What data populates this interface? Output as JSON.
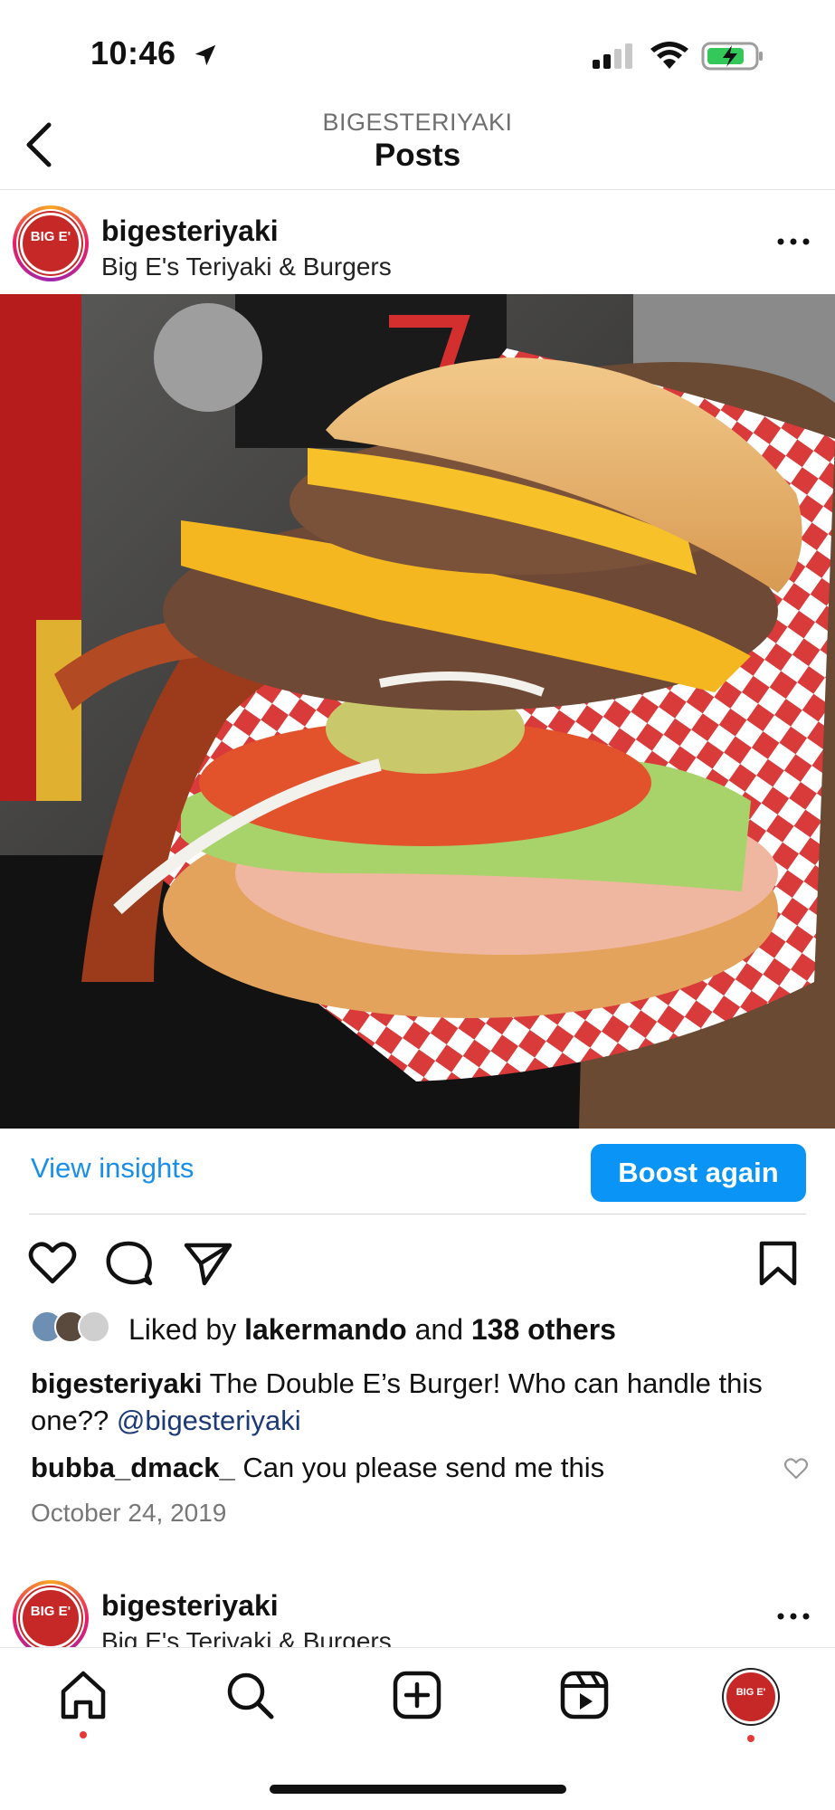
{
  "status_bar": {
    "time": "10:46",
    "icons": [
      "location-arrow-icon",
      "cellular-signal-icon",
      "wifi-icon",
      "battery-charging-icon"
    ]
  },
  "nav": {
    "subtitle": "BIGESTERIYAKI",
    "title": "Posts",
    "back_icon": "chevron-left-icon"
  },
  "post": {
    "username": "bigesteriyaki",
    "subtitle": "Big E's Teriyaki & Burgers",
    "avatar_text": "BIG E'",
    "more_icon": "more-horizontal-icon",
    "image_description_icon": "burger-photo",
    "insights_label": "View insights",
    "boost_label": "Boost again",
    "actions": [
      "heart-icon",
      "comment-icon",
      "share-icon",
      "bookmark-icon"
    ],
    "likes": {
      "prefix": "Liked by",
      "user": "lakermando",
      "middle": "and",
      "others": "138 others"
    },
    "caption": {
      "user": "bigesteriyaki",
      "text": "The Double E’s Burger! Who can handle this one??",
      "mention": "@bigesteriyaki"
    },
    "comment": {
      "user": "bubba_dmack_",
      "text": "Can you please send me this"
    },
    "date": "October 24, 2019"
  },
  "next_post": {
    "username": "bigesteriyaki",
    "subtitle": "Big E's Teriyaki & Burgers"
  },
  "tab_bar": {
    "tabs": [
      "home-icon",
      "search-icon",
      "create-post-icon",
      "reels-icon",
      "profile-avatar"
    ],
    "profile_text": "BIG E'"
  },
  "colors": {
    "accent_blue": "#0a95f6",
    "link_blue": "#1a8fe8",
    "mention_blue": "#1c3a75",
    "brand_red": "#c62828"
  }
}
